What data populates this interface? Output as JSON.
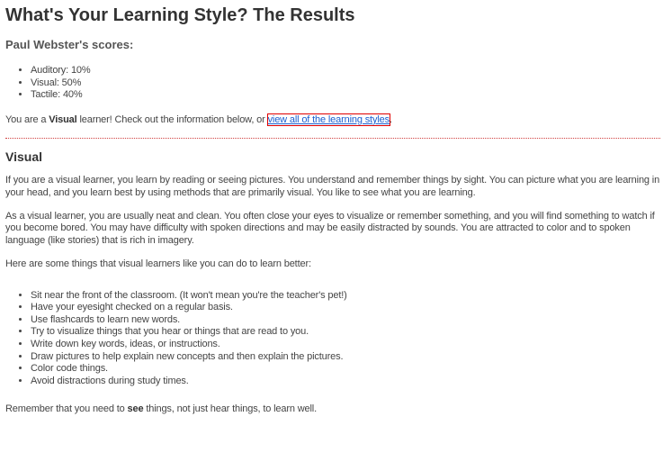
{
  "title": "What's Your Learning Style? The Results",
  "scores_heading": "Paul Webster's scores:",
  "scores": [
    "Auditory: 10%",
    "Visual: 50%",
    "Tactile: 40%"
  ],
  "result": {
    "pre": "You are a ",
    "style": "Visual",
    "post": " learner! Check out the information below, or ",
    "link": "view all of the learning styles",
    "end": "."
  },
  "section_title": "Visual",
  "paragraphs": [
    "If you are a visual learner, you learn by reading or seeing pictures. You understand and remember things by sight. You can picture what you are learning in your head, and you learn best by using methods that are primarily visual. You like to see what you are learning.",
    "As a visual learner, you are usually neat and clean. You often close your eyes to visualize or remember something, and you will find something to watch if you become bored. You may have difficulty with spoken directions and may be easily distracted by sounds. You are attracted to color and to spoken language (like stories) that is rich in imagery.",
    "Here are some things that visual learners like you can do to learn better:"
  ],
  "tips": [
    "Sit near the front of the classroom. (It won't mean you're the teacher's pet!)",
    "Have your eyesight checked on a regular basis.",
    "Use flashcards to learn new words.",
    "Try to visualize things that you hear or things that are read to you.",
    "Write down key words, ideas, or instructions.",
    "Draw pictures to help explain new concepts and then explain the pictures.",
    "Color code things.",
    "Avoid distractions during study times."
  ],
  "closing": {
    "pre": "Remember that you need to ",
    "bold": "see",
    "post": " things, not just hear things, to learn well."
  }
}
